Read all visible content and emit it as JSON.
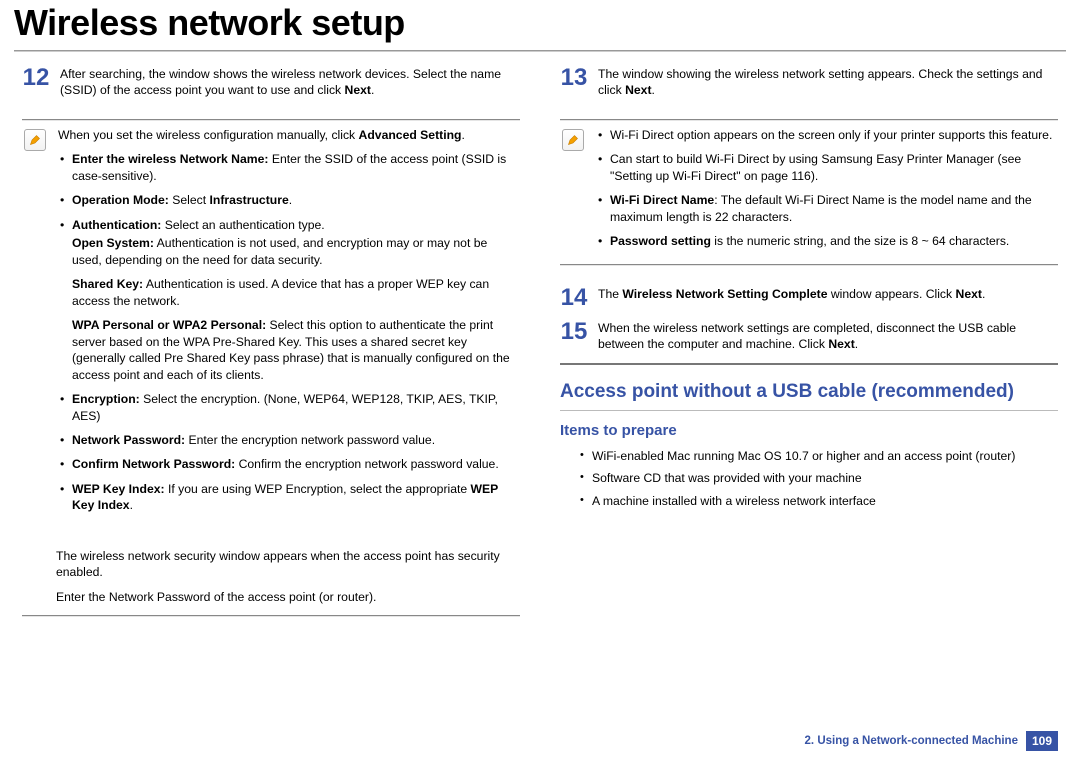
{
  "title": "Wireless network setup",
  "left": {
    "step12": {
      "num": "12",
      "text_a": "After searching, the window shows the wireless network devices. Select the name (SSID) of the access point you want to use and click ",
      "text_b": "Next",
      "text_c": "."
    },
    "info": {
      "intro_a": "When you set the wireless configuration manually, click ",
      "intro_b": "Advanced Setting",
      "intro_c": ".",
      "items": [
        {
          "lead": "Enter the wireless Network Name:",
          "rest": " Enter the SSID of the access point (SSID is case-sensitive)."
        },
        {
          "lead": "Operation Mode:",
          "rest": " Select ",
          "bold2": "Infrastructure",
          "tail": "."
        },
        {
          "lead": "Authentication:",
          "rest": " Select an authentication type."
        }
      ],
      "auth_sub": [
        {
          "lead": "Open System:",
          "rest": " Authentication is not used, and encryption may or may not be used, depending on the need for data security."
        },
        {
          "lead": "Shared Key:",
          "rest": " Authentication is used. A device that has a proper WEP key can access the network."
        },
        {
          "lead": "WPA Personal or WPA2 Personal:",
          "rest": " Select this option to authenticate the print server based on the WPA Pre-Shared Key. This uses a shared secret key (generally called Pre Shared Key pass phrase) that is manually configured on the access point and each of its clients."
        }
      ],
      "items2": [
        {
          "lead": "Encryption:",
          "rest": " Select the encryption. (None, WEP64, WEP128, TKIP, AES, TKIP, AES)"
        },
        {
          "lead": "Network Password:",
          "rest": " Enter the encryption network password value."
        },
        {
          "lead": "Confirm Network Password:",
          "rest": " Confirm the encryption network password value."
        },
        {
          "lead": "WEP Key Index:",
          "rest": " If you are using WEP Encryption, select the appropriate ",
          "bold2": "WEP Key Index",
          "tail": "."
        }
      ]
    },
    "tail1": "The wireless network security window appears when the access point has security enabled.",
    "tail2": "Enter the Network Password of the access point (or router)."
  },
  "right": {
    "step13": {
      "num": "13",
      "text_a": "The window showing the wireless network setting appears. Check the settings and click ",
      "text_b": "Next",
      "text_c": "."
    },
    "info": {
      "items": [
        {
          "text": "Wi-Fi Direct option appears on the screen only if your printer supports this feature."
        },
        {
          "text_a": "Can start to build Wi-Fi Direct by using Samsung Easy Printer Manager (see \"Setting up Wi-Fi Direct\" on page 116)."
        },
        {
          "lead": "Wi-Fi Direct Name",
          "rest": ": The default Wi-Fi Direct Name is the model name and the maximum length is 22 characters."
        },
        {
          "lead": "Password setting",
          "rest": " is the numeric string, and the size is 8 ~ 64 characters."
        }
      ]
    },
    "step14": {
      "num": "14",
      "text_a": "The ",
      "text_b": "Wireless Network Setting Complete",
      "text_c": " window appears. Click ",
      "text_d": "Next",
      "text_e": "."
    },
    "step15": {
      "num": "15",
      "text_a": "When the wireless network settings are completed, disconnect the USB cable between the computer and machine. Click ",
      "text_b": "Next",
      "text_c": "."
    },
    "h2": "Access point without a USB cable (recommended)",
    "h3": "Items to prepare",
    "prepare": [
      "WiFi-enabled Mac running Mac OS 10.7 or higher and an access point (router)",
      "Software CD that was provided with your machine",
      "A machine installed with a wireless network interface"
    ]
  },
  "footer": {
    "chapter": "2.  Using a Network-connected Machine",
    "page": "109"
  }
}
